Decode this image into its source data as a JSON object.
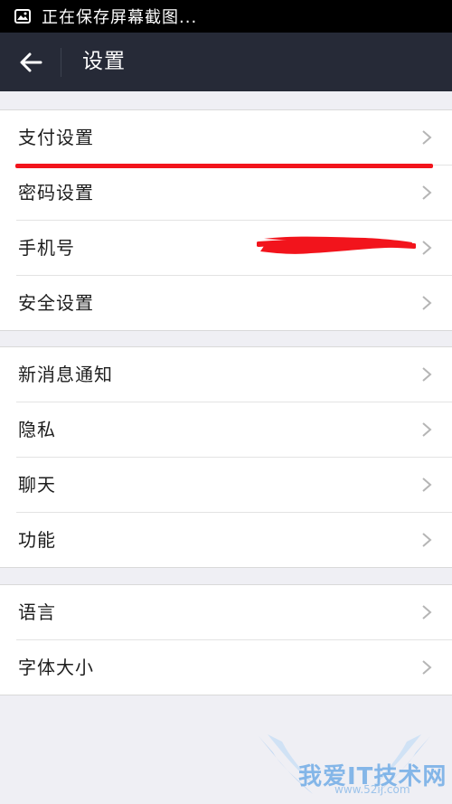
{
  "status_bar": {
    "text": "正在保存屏幕截图...",
    "icon": "image-icon"
  },
  "nav": {
    "back_icon": "back-arrow-icon",
    "title": "设置"
  },
  "groups": [
    {
      "items": [
        {
          "label": "支付设置",
          "icon": "chevron-right-icon"
        },
        {
          "label": "密码设置",
          "icon": "chevron-right-icon"
        },
        {
          "label": "手机号",
          "icon": "chevron-right-icon"
        },
        {
          "label": "安全设置",
          "icon": "chevron-right-icon"
        }
      ]
    },
    {
      "items": [
        {
          "label": "新消息通知",
          "icon": "chevron-right-icon"
        },
        {
          "label": "隐私",
          "icon": "chevron-right-icon"
        },
        {
          "label": "聊天",
          "icon": "chevron-right-icon"
        },
        {
          "label": "功能",
          "icon": "chevron-right-icon"
        }
      ]
    },
    {
      "items": [
        {
          "label": "语言",
          "icon": "chevron-right-icon"
        },
        {
          "label": "字体大小",
          "icon": "chevron-right-icon"
        }
      ]
    }
  ],
  "watermark": {
    "text": "我爱IT技术网",
    "url": "www.52ij.com"
  },
  "colors": {
    "nav_background": "#262a37",
    "page_background": "#efeff4",
    "annotation_red": "#f2141c"
  }
}
